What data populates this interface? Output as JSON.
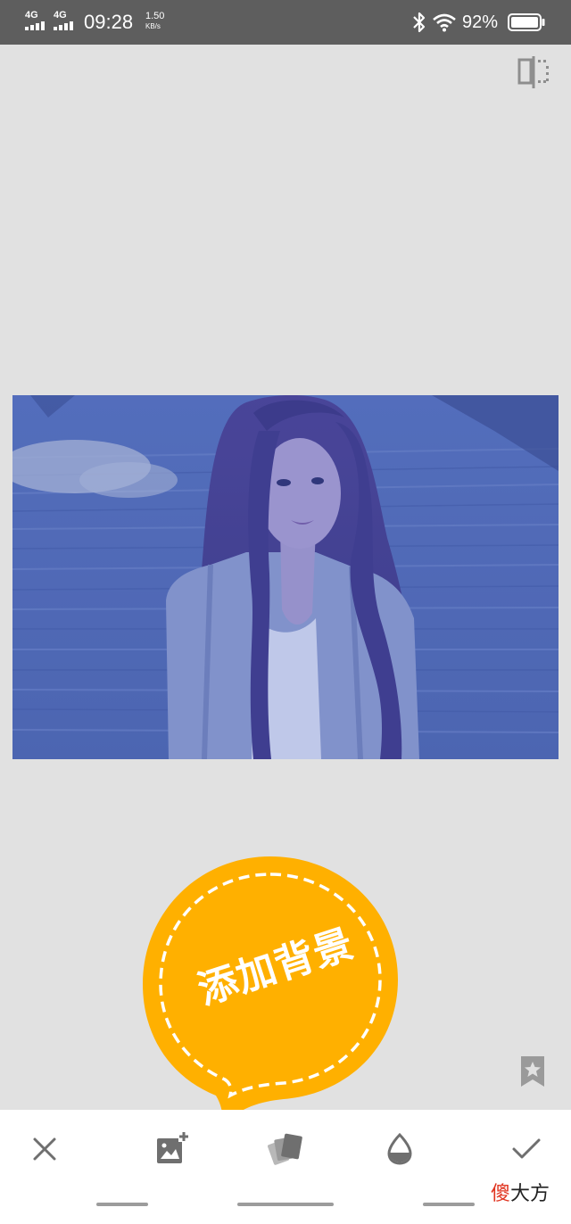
{
  "status_bar": {
    "signal_1": "4G",
    "signal_2": "4G",
    "time": "09:28",
    "speed_value": "1.50",
    "speed_unit": "KB/s",
    "battery_percent": "92%",
    "icons": [
      "bluetooth-icon",
      "wifi-icon",
      "battery-icon"
    ]
  },
  "top_actions": {
    "compare_icon": "compare-split-icon"
  },
  "tip": {
    "text": "添加背景",
    "color": "#ffb000"
  },
  "right_actions": {
    "favorite_icon": "bookmark-star-icon"
  },
  "toolbar": {
    "tools": [
      "close-icon",
      "add-image-icon",
      "style-cards-icon",
      "drop-icon",
      "check-icon"
    ]
  },
  "watermark": {
    "first_char": "傻",
    "rest": "大方"
  },
  "colors": {
    "background": "#e1e1e1",
    "status_bar": "#5e5e5e",
    "photo_tint": "#5b72bd",
    "icon_gray": "#6f6f6f"
  }
}
